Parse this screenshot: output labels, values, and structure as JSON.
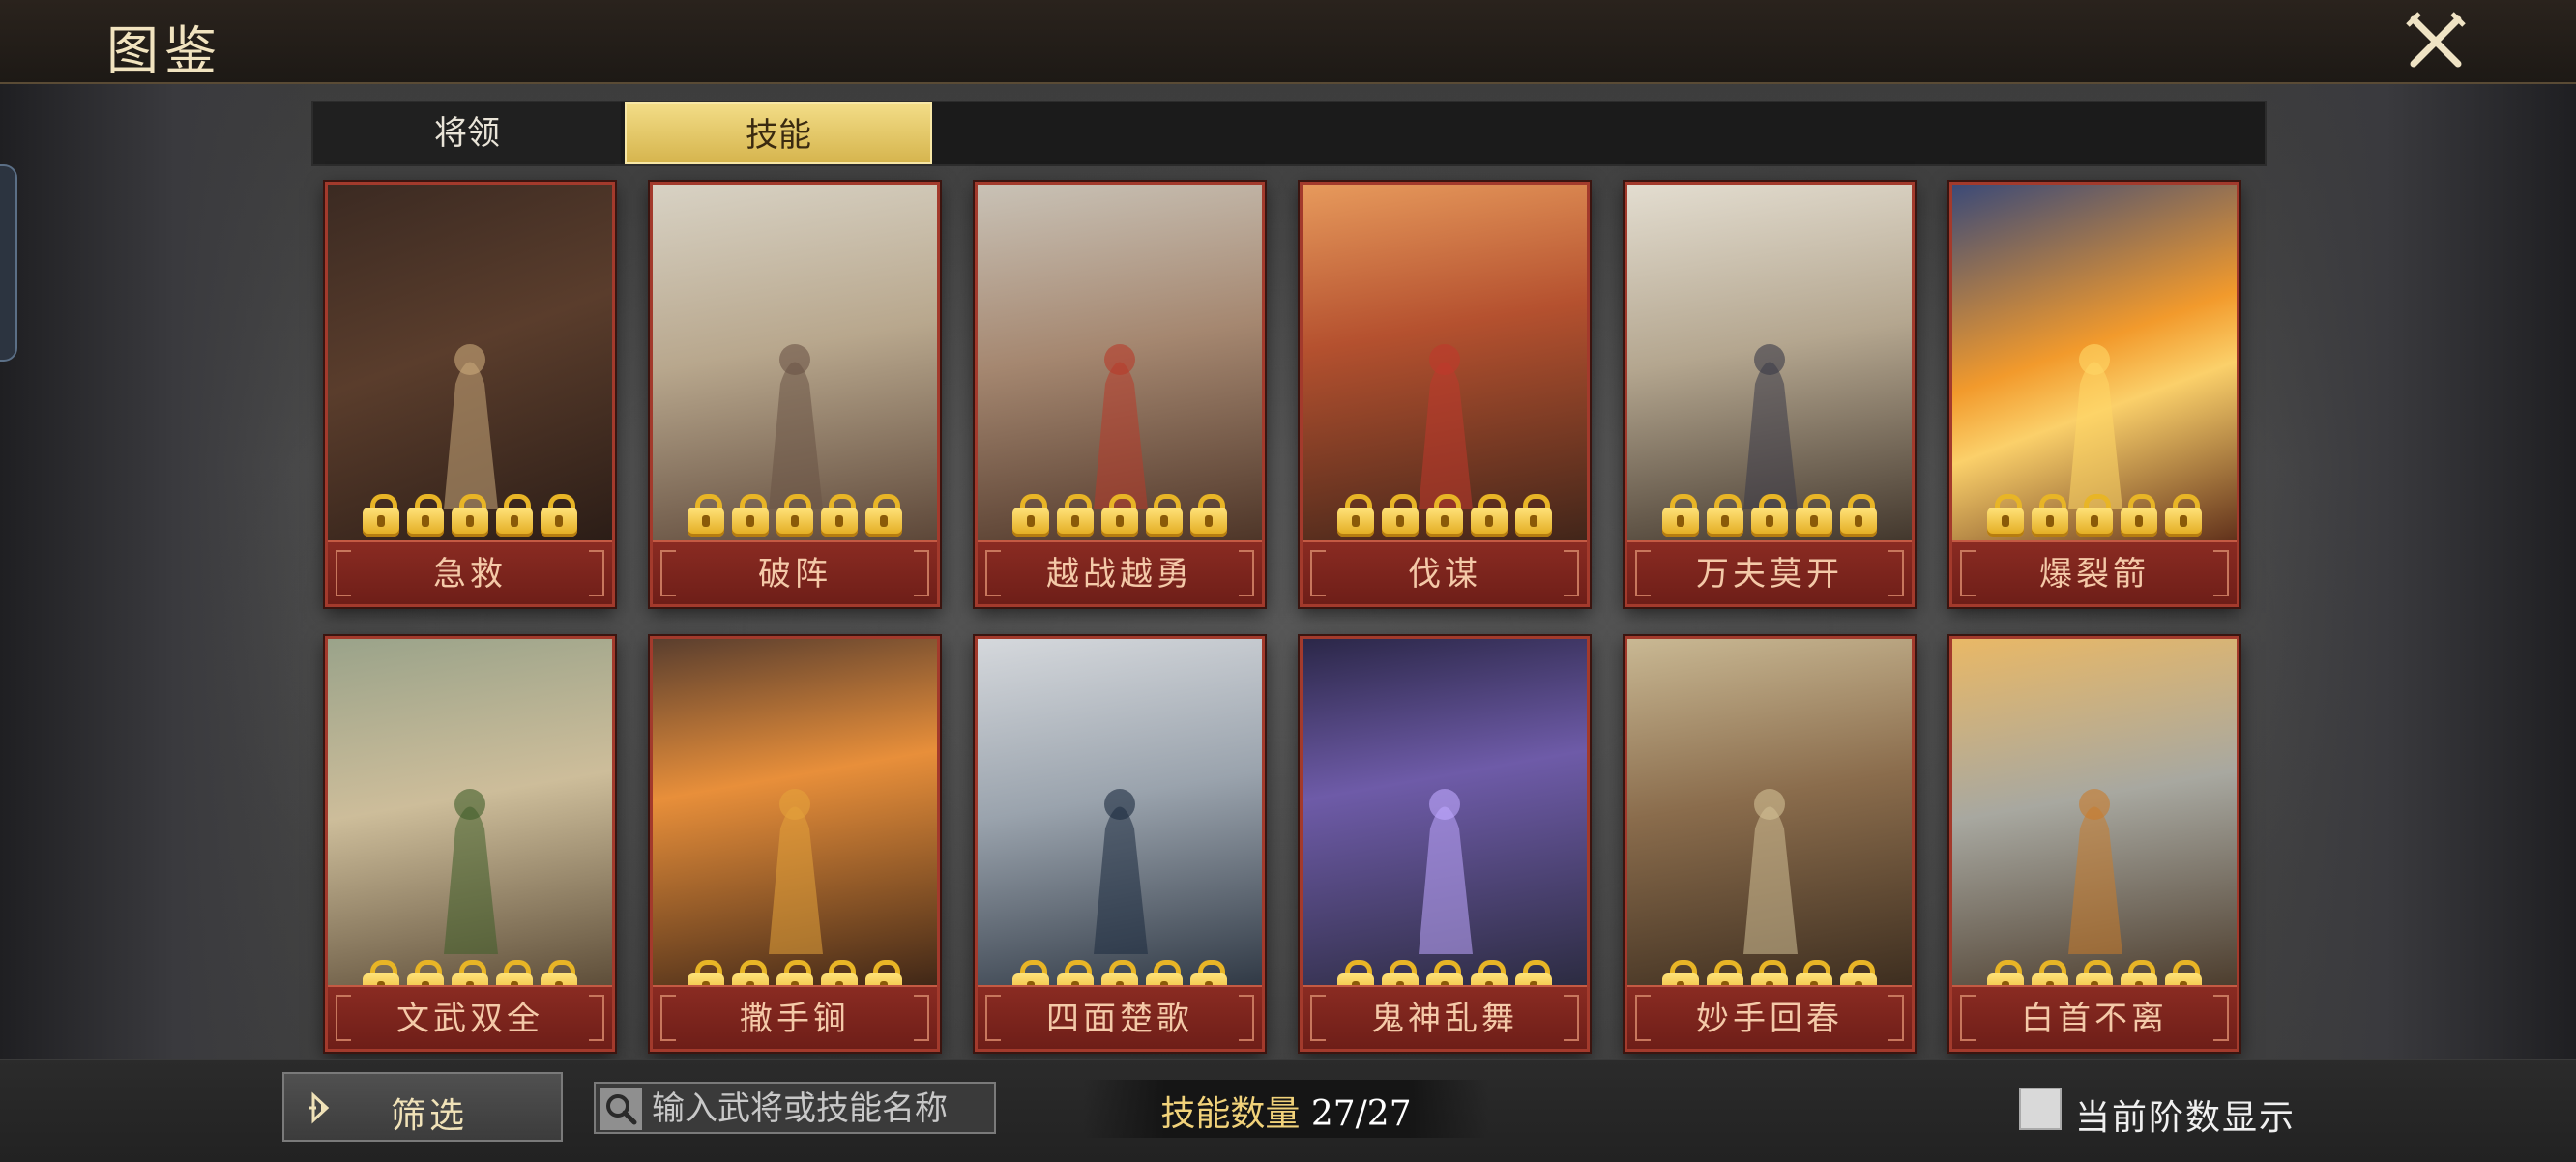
{
  "header": {
    "title": "图鉴"
  },
  "tabs": [
    {
      "label": "将领",
      "active": false
    },
    {
      "label": "技能",
      "active": true
    }
  ],
  "cards": [
    {
      "name": "急救",
      "locks": 5,
      "icon": "herbal-medicine-art"
    },
    {
      "name": "破阵",
      "locks": 5,
      "icon": "cavalry-charge-art"
    },
    {
      "name": "越战越勇",
      "locks": 5,
      "icon": "banner-warrior-art"
    },
    {
      "name": "伐谋",
      "locks": 5,
      "icon": "caped-general-art"
    },
    {
      "name": "万夫莫开",
      "locks": 5,
      "icon": "spear-guard-art"
    },
    {
      "name": "爆裂箭",
      "locks": 5,
      "icon": "flaming-arrow-art"
    },
    {
      "name": "文武双全",
      "locks": 5,
      "icon": "scroll-sword-art"
    },
    {
      "name": "撒手锏",
      "locks": 5,
      "icon": "sunset-warrior-art"
    },
    {
      "name": "四面楚歌",
      "locks": 5,
      "icon": "cloaked-strategist-art"
    },
    {
      "name": "鬼神乱舞",
      "locks": 5,
      "icon": "storm-vortex-art"
    },
    {
      "name": "妙手回春",
      "locks": 5,
      "icon": "healer-elder-art"
    },
    {
      "name": "白首不离",
      "locks": 5,
      "icon": "elderly-couple-art"
    }
  ],
  "bottom": {
    "filter_label": "筛选",
    "search_placeholder": "输入武将或技能名称",
    "count_label": "技能数量",
    "count_value": "27/27",
    "toggle_label": "当前阶数显示",
    "toggle_checked": false
  },
  "colors": {
    "accent_gold": "#e2c161",
    "card_border": "#a33a2c",
    "lock_gold": "#f2c94c"
  }
}
